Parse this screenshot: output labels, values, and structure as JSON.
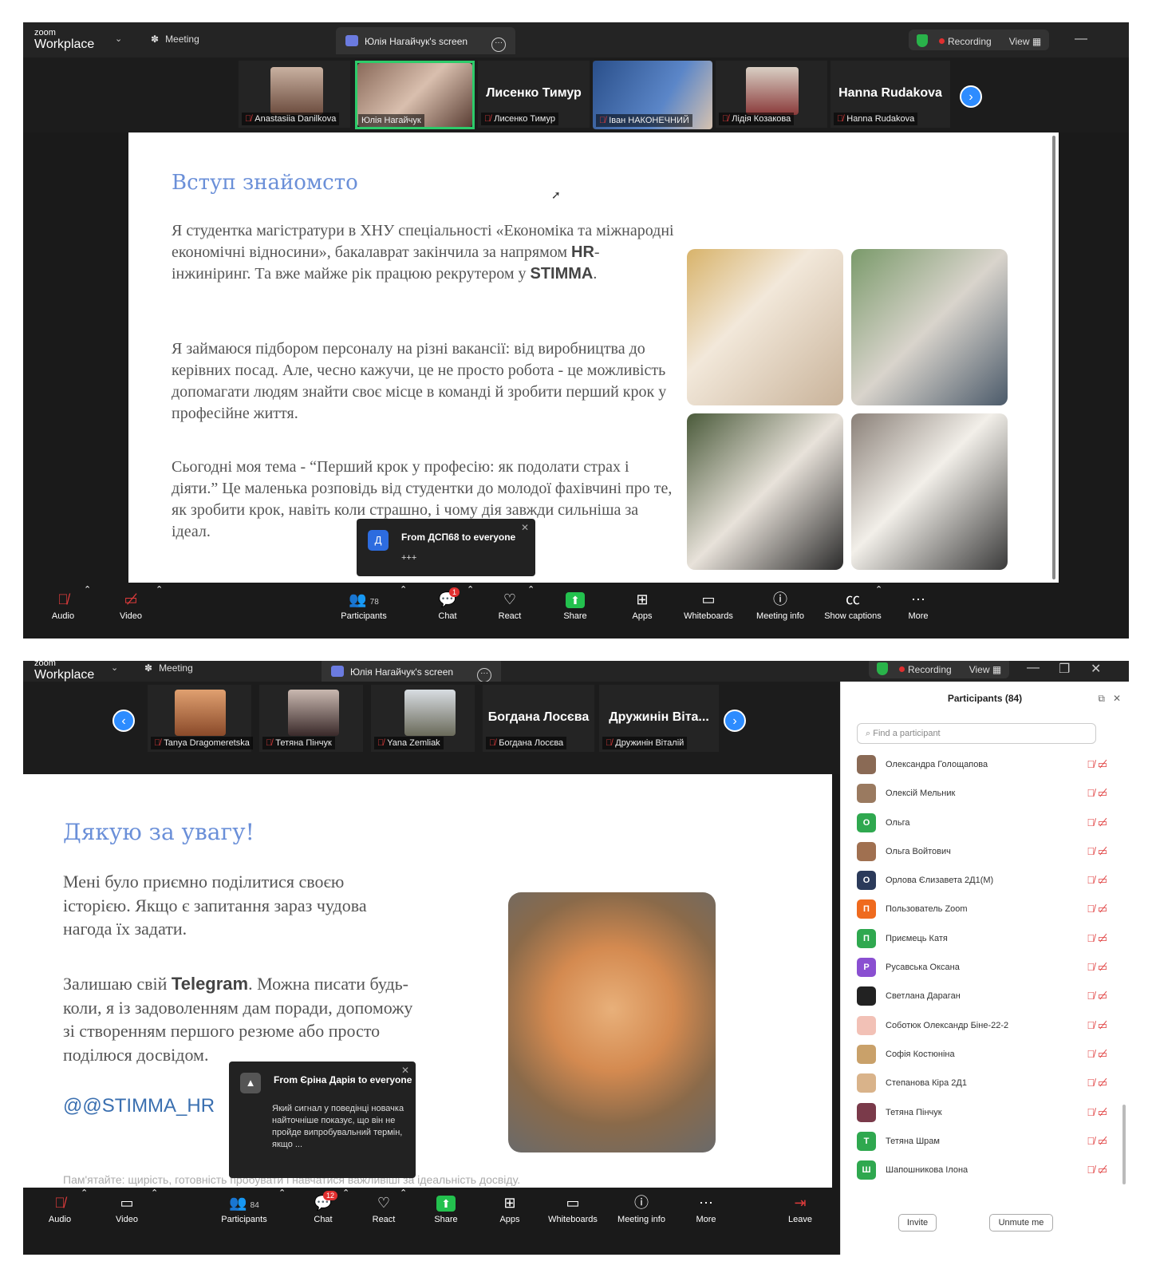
{
  "shot1": {
    "app": {
      "brand_small": "zoom",
      "brand_big": "Workplace",
      "meeting_label": "Meeting",
      "screen_tab": "Юлія Нагайчук's screen",
      "recording": "Recording",
      "view": "View"
    },
    "participants_strip": [
      {
        "name": "Anastasiia Danilkova",
        "big": ""
      },
      {
        "name": "Юлія Нагайчук",
        "big": ""
      },
      {
        "name": "Лисенко Тимур",
        "big": "Лисенко Тимур"
      },
      {
        "name": "Іван НАКОНЕЧНИЙ",
        "big": ""
      },
      {
        "name": "Лідія Козакова",
        "big": ""
      },
      {
        "name": "Hanna Rudakova",
        "big": "Hanna Rudakova"
      }
    ],
    "slide": {
      "title": "Вступ знайомсто",
      "p1_a": "Я студентка магістратури в ХНУ спеціальності «Економіка та міжнародні економічні відносини», бакалаврат закінчила за напрямом ",
      "p1_hr": "HR",
      "p1_b": "-інжиніринг. Та вже майже рік працюю рекрутером у ",
      "p1_stimma": "STIMMA",
      "p1_c": ".",
      "p2": "Я займаюся підбором персоналу на різні вакансії: від виробництва до керівних посад. Але, чесно кажучи, це не просто робота - це можливість допомагати людям знайти своє місце в команді й зробити перший крок у професійне життя.",
      "p3": "Сьогодні моя тема - “Перший крок у професію: як подолати страх і діяти.” Це маленька розповідь від студентки до молодої фахівчині про те, як зробити крок, навіть коли страшно, і чому дія завжди сильніша за ідеал."
    },
    "toast": {
      "avatar": "Д",
      "from": "From ДСП68 to everyone",
      "msg": "+++"
    },
    "toolbar": {
      "audio": "Audio",
      "video": "Video",
      "participants": "Participants",
      "participants_count": "78",
      "chat": "Chat",
      "chat_badge": "1",
      "react": "React",
      "share": "Share",
      "apps": "Apps",
      "whiteboards": "Whiteboards",
      "meeting_info": "Meeting info",
      "captions": "Show captions",
      "more": "More"
    }
  },
  "shot2": {
    "app": {
      "brand_small": "zoom",
      "brand_big": "Workplace",
      "meeting_label": "Meeting",
      "screen_tab": "Юлія Нагайчук's screen",
      "recording": "Recording",
      "view": "View"
    },
    "participants_strip": [
      {
        "name": "Tanya Dragomeretska",
        "big": ""
      },
      {
        "name": "Тетяна Пінчук",
        "big": ""
      },
      {
        "name": "Yana Zemliak",
        "big": ""
      },
      {
        "name": "Богдана Лосєва",
        "big": "Богдана Лосєва"
      },
      {
        "name": "Дружинін Віталій",
        "big": "Дружинін Віта..."
      }
    ],
    "slide": {
      "title": "Дякую за увагу!",
      "p1": "Мені було приємно поділитися своєю історією. Якщо є запитання зараз чудова нагода їх задати.",
      "p2_a": "Залишаю свій ",
      "p2_tg": "Telegram",
      "p2_b": ". Можна писати будь-коли, я із задоволенням дам поради, допоможу зі створенням першого резюме або просто поділюся досвідом.",
      "handle": "@@STIMMA_HR",
      "footer": "Пам'ятайте: щирість, готовність пробувати і навчатися важливіші за ідеальність досвіду."
    },
    "toast": {
      "from": "From Єріна Дарія to everyone",
      "msg": "Який сигнал у поведінці новачка найточніше показує, що він не пройде випробувальний термін, якщо ..."
    },
    "panel": {
      "title": "Participants (84)",
      "search_placeholder": "Find a participant",
      "invite": "Invite",
      "unmute": "Unmute me",
      "people": [
        {
          "name": "Олександра Голощапова",
          "initial": "",
          "color": "#8a6a55"
        },
        {
          "name": "Олексій Мельник",
          "initial": "",
          "color": "#9a7a60"
        },
        {
          "name": "Ольга",
          "initial": "О",
          "color": "#2fa84f"
        },
        {
          "name": "Ольга Войтович",
          "initial": "",
          "color": "#a07050"
        },
        {
          "name": "Орлова Єлизавета 2Д1(М)",
          "initial": "О",
          "color": "#2b3a5a"
        },
        {
          "name": "Пользователь Zoom",
          "initial": "П",
          "color": "#ef6a1e"
        },
        {
          "name": "Приємець Катя",
          "initial": "П",
          "color": "#2fa84f"
        },
        {
          "name": "Русавська Оксана",
          "initial": "Р",
          "color": "#8a4fd1"
        },
        {
          "name": "Светлана Дараган",
          "initial": "",
          "color": "#222222"
        },
        {
          "name": "Соботюк Олександр Біне-22-2",
          "initial": "",
          "color": "#f2c1b6"
        },
        {
          "name": "Софія Костюніна",
          "initial": "",
          "color": "#c9a16a"
        },
        {
          "name": "Степанова Кіра 2Д1",
          "initial": "",
          "color": "#d9b38a"
        },
        {
          "name": "Тетяна Пінчук",
          "initial": "",
          "color": "#7a3a4a"
        },
        {
          "name": "Тетяна Шрам",
          "initial": "Т",
          "color": "#2fa84f"
        },
        {
          "name": "Шапошникова Ілона",
          "initial": "Ш",
          "color": "#2fa84f"
        }
      ]
    },
    "toolbar": {
      "audio": "Audio",
      "video": "Video",
      "participants": "Participants",
      "participants_count": "84",
      "chat": "Chat",
      "chat_badge": "12",
      "react": "React",
      "share": "Share",
      "apps": "Apps",
      "whiteboards": "Whiteboards",
      "meeting_info": "Meeting info",
      "more": "More",
      "leave": "Leave"
    }
  },
  "colors": {
    "zoom_blue": "#2d8cff",
    "share_green": "#23c14e",
    "muted_red": "#e03c3c",
    "slide_title": "#6a8fd8",
    "active_tile": "#2dcb6a"
  }
}
